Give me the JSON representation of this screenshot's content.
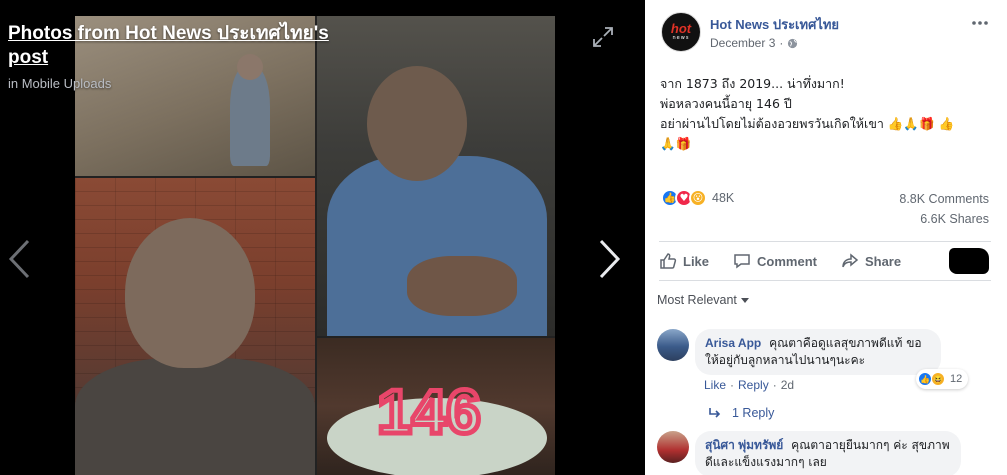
{
  "viewer": {
    "title": "Photos from Hot News ประเทศไทย's post",
    "subtitle": "in Mobile Uploads",
    "icons": {
      "expand": "expand-icon",
      "prev": "chevron-left-icon",
      "next": "chevron-right-icon"
    },
    "cake_number": "146"
  },
  "post": {
    "page_name": "Hot News ประเทศไทย",
    "avatar_text": "hot",
    "avatar_subtext": "news",
    "date": "December 3",
    "meta_separator": "·",
    "text_lines": [
      "จาก 1873 ถึง 2019... น่าทึ่งมาก!",
      "พ่อหลวงคนนี้อายุ 146 ปี",
      "อย่าผ่านไปโดยไม่ต้องอวยพรวันเกิดให้เขา 👍🙏🎁 👍",
      "🙏🎁"
    ],
    "reaction_count": "48K",
    "comments": "8.8K Comments",
    "shares": "6.6K Shares"
  },
  "actions": {
    "like": "Like",
    "comment": "Comment",
    "share": "Share"
  },
  "sort_label": "Most Relevant",
  "comments": [
    {
      "author": "Arisa App",
      "text": "คุณตาคือดูแลสุขภาพดีแท้ ขอให้อยู่กับลูกหลานไปนานๆนะคะ",
      "like": "Like",
      "reply": "Reply",
      "time": "2d",
      "sep": "·",
      "reaction_count": "12"
    },
    {
      "author": "สุนิศา พุ่มทรัพย์",
      "text": "คุณตาอายุยืนมากๆ ค่ะ สุขภาพดีและแข็งแรงมากๆ เลย"
    }
  ],
  "reply_thread": "1 Reply",
  "colors": {
    "link": "#385898",
    "like_blue": "#1877f2",
    "love_red": "#f0284a",
    "wow_yellow": "#f7b125"
  }
}
